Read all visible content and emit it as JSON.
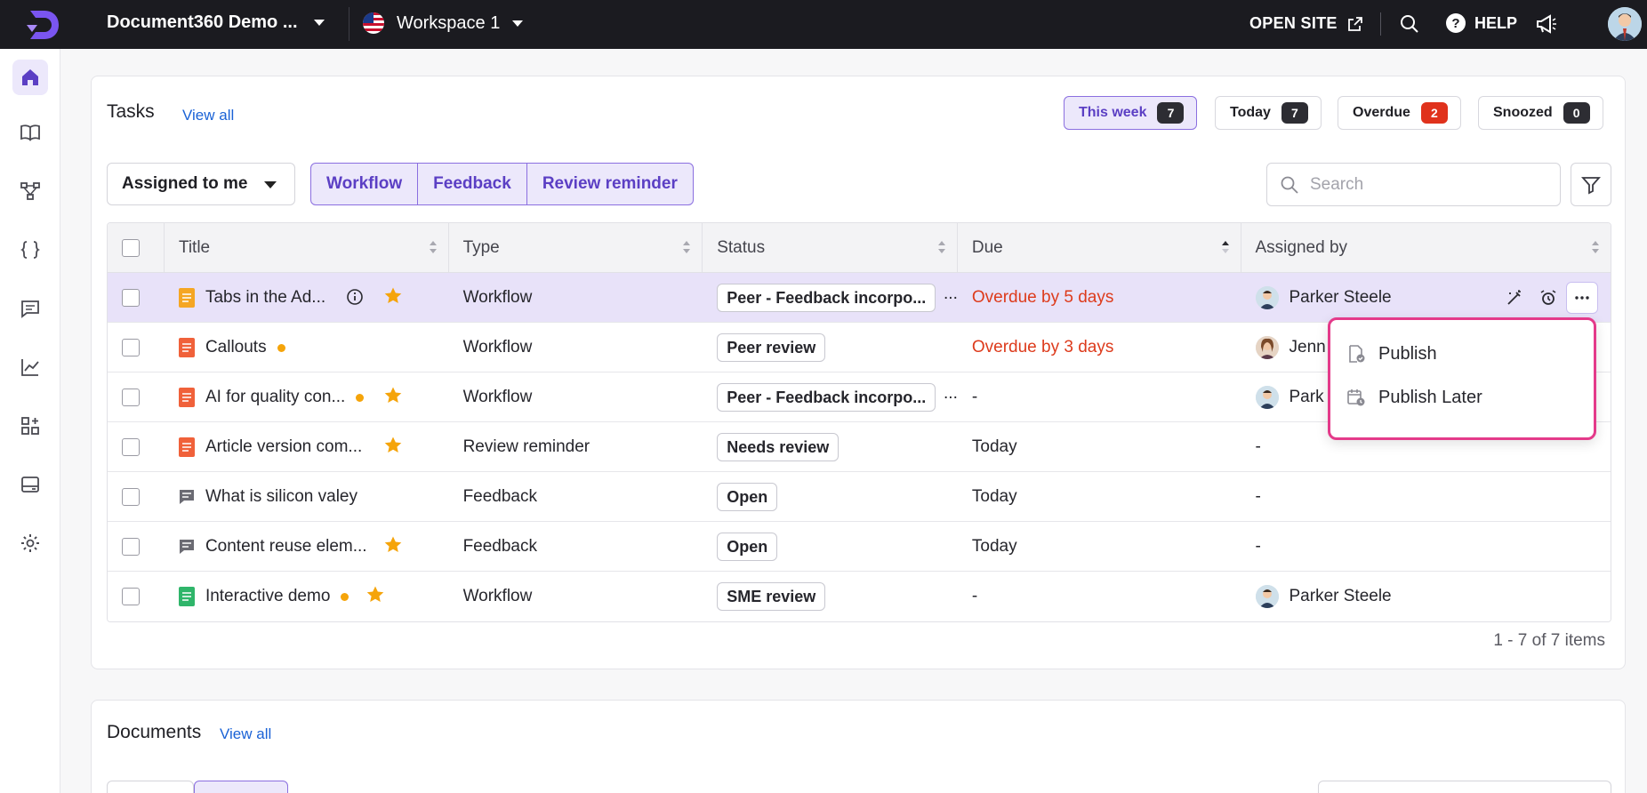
{
  "topbar": {
    "project": "Document360 Demo ...",
    "workspace": "Workspace 1",
    "open_site": "OPEN SITE",
    "help": "HELP",
    "help_glyph": "?"
  },
  "sidebar": {
    "items": [
      "home-icon",
      "book-icon",
      "category-tree-icon",
      "api-braces-icon",
      "feedback-icon",
      "analytics-icon",
      "integrations-icon",
      "widget-icon",
      "settings-icon"
    ]
  },
  "tasks": {
    "title": "Tasks",
    "view_all": "View all",
    "pills": [
      {
        "label": "This week",
        "count": "7"
      },
      {
        "label": "Today",
        "count": "7"
      },
      {
        "label": "Overdue",
        "count": "2"
      },
      {
        "label": "Snoozed",
        "count": "0"
      }
    ],
    "assigned_filter": "Assigned to me",
    "type_filters": [
      "Workflow",
      "Feedback",
      "Review reminder"
    ],
    "search_placeholder": "Search",
    "columns": [
      "Title",
      "Type",
      "Status",
      "Due",
      "Assigned by"
    ],
    "rows": [
      {
        "title": "Tabs in the Ad...",
        "type": "Workflow",
        "status": "Peer - Feedback incorpo...",
        "due": "Overdue by 5 days",
        "assigned_by": "Parker Steele",
        "doc_color": "#f5a623"
      },
      {
        "title": "Callouts",
        "type": "Workflow",
        "status": "Peer review",
        "due": "Overdue by 3 days",
        "assigned_by": "Jenn",
        "doc_color": "#f0613a"
      },
      {
        "title": "AI for quality con...",
        "type": "Workflow",
        "status": "Peer - Feedback incorpo...",
        "due": "-",
        "assigned_by": "Park",
        "doc_color": "#f0613a"
      },
      {
        "title": "Article version com...",
        "type": "Review reminder",
        "status": "Needs review",
        "due": "Today",
        "assigned_by": "-",
        "doc_color": "#f0613a"
      },
      {
        "title": "What is silicon valey",
        "type": "Feedback",
        "status": "Open",
        "due": "Today",
        "assigned_by": "-",
        "doc_color": "#6b6b73"
      },
      {
        "title": "Content reuse elem...",
        "type": "Feedback",
        "status": "Open",
        "due": "Today",
        "assigned_by": "-",
        "doc_color": "#6b6b73"
      },
      {
        "title": "Interactive demo",
        "type": "Workflow",
        "status": "SME review",
        "due": "-",
        "assigned_by": "Parker Steele",
        "doc_color": "#2fb56a"
      }
    ],
    "ellipsis": "...",
    "pager": "1 - 7 of 7 items"
  },
  "menu": {
    "publish": "Publish",
    "publish_later": "Publish Later"
  },
  "documents": {
    "title": "Documents",
    "view_all": "View all"
  },
  "colors": {
    "accent": "#5b3fc4",
    "accent_bg": "#ece8fb",
    "overdue": "#dd3b1c",
    "link": "#1a62d6",
    "menu_border": "#e43a8a"
  }
}
